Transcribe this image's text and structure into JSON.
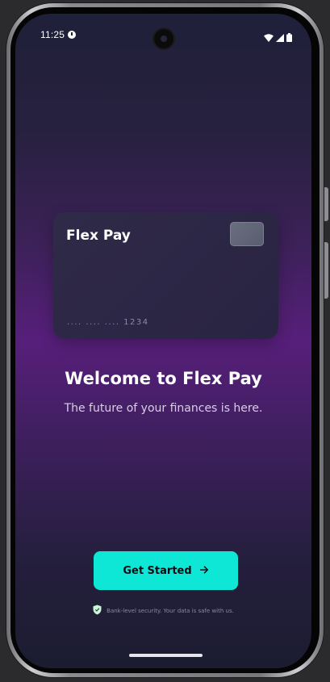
{
  "status_bar": {
    "time": "11:25",
    "icons": [
      "alert-circle-icon",
      "wifi-icon",
      "signal-icon",
      "battery-icon"
    ]
  },
  "card": {
    "title": "Flex Pay",
    "number": ".... .... .... 1234"
  },
  "welcome": {
    "title": "Welcome to Flex Pay",
    "subtitle": "The future of your finances is here."
  },
  "cta": {
    "label": "Get Started",
    "icon": "arrow-right-icon"
  },
  "security": {
    "icon": "shield-icon",
    "text": "Bank-level security. Your data is safe with us."
  },
  "colors": {
    "accent": "#0ee6d6",
    "background_top": "#1f2039",
    "background_mid": "#571f7b",
    "card": "#2f2a48"
  }
}
